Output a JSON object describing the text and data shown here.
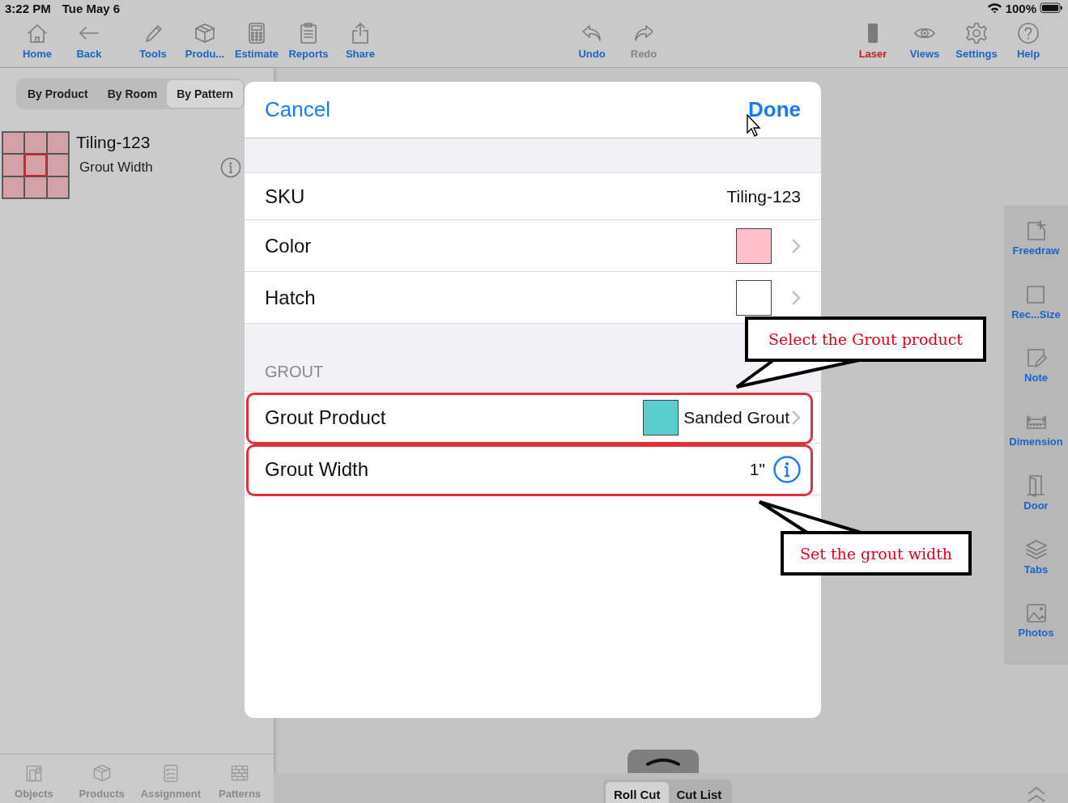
{
  "status_bar": {
    "time": "3:22 PM",
    "date": "Tue May 6",
    "battery": "100%"
  },
  "toolbar": {
    "left": [
      {
        "label": "Home",
        "kind": "home",
        "disabled": false,
        "alert": false
      },
      {
        "label": "Back",
        "kind": "back",
        "disabled": false,
        "alert": false
      },
      {
        "label": "Tools",
        "kind": "pencil",
        "disabled": false,
        "alert": false
      },
      {
        "label": "Produ...",
        "kind": "box",
        "disabled": false,
        "alert": false
      },
      {
        "label": "Estimate",
        "kind": "calculator",
        "disabled": false,
        "alert": false
      },
      {
        "label": "Reports",
        "kind": "clipboard",
        "disabled": false,
        "alert": false
      },
      {
        "label": "Share",
        "kind": "share",
        "disabled": false,
        "alert": false
      }
    ],
    "center": [
      {
        "label": "Undo",
        "kind": "undo",
        "disabled": false,
        "alert": false
      },
      {
        "label": "Redo",
        "kind": "redo",
        "disabled": true,
        "alert": false
      }
    ],
    "right": [
      {
        "label": "Laser",
        "kind": "laser",
        "disabled": false,
        "alert": true
      },
      {
        "label": "Views",
        "kind": "eye",
        "disabled": false,
        "alert": false
      },
      {
        "label": "Settings",
        "kind": "gear",
        "disabled": false,
        "alert": false
      },
      {
        "label": "Help",
        "kind": "help",
        "disabled": false,
        "alert": false
      }
    ]
  },
  "left_panel": {
    "segments": [
      {
        "label": "By Product",
        "selected": false
      },
      {
        "label": "By Room",
        "selected": false
      },
      {
        "label": "By Pattern",
        "selected": true
      }
    ],
    "patterns": [
      {
        "title": "Tiling-123",
        "subtitle": "Grout Width",
        "color": "#d4a1a8"
      }
    ],
    "bottom_tabs": [
      {
        "label": "Objects",
        "kind": "objects"
      },
      {
        "label": "Products",
        "kind": "box"
      },
      {
        "label": "Assignment",
        "kind": "checklist"
      },
      {
        "label": "Patterns",
        "kind": "bricks"
      }
    ]
  },
  "right_tools": [
    {
      "label": "Freedraw",
      "kind": "freedraw"
    },
    {
      "label": "Rec...Size",
      "kind": "square"
    },
    {
      "label": "Note",
      "kind": "note"
    },
    {
      "label": "Dimension",
      "kind": "dimension"
    },
    {
      "label": "Door",
      "kind": "door"
    },
    {
      "label": "Tabs",
      "kind": "layers"
    },
    {
      "label": "Photos",
      "kind": "photo"
    }
  ],
  "bottom_bar": {
    "view_tabs": [
      {
        "label": "Roll Cut",
        "selected": true
      },
      {
        "label": "Cut List",
        "selected": false
      }
    ]
  },
  "dialog": {
    "cancel": "Cancel",
    "done": "Done",
    "rows": [
      {
        "kind": "text",
        "label": "SKU",
        "value": "Tiling-123",
        "highlighted": false
      },
      {
        "kind": "swatch",
        "label": "Color",
        "color": "#ffc0cb",
        "highlighted": false
      },
      {
        "kind": "swatch",
        "label": "Hatch",
        "color": "#ffffff",
        "highlighted": false
      }
    ],
    "section": "GROUT",
    "grout_rows": [
      {
        "kind": "swatch_text",
        "label": "Grout Product",
        "color": "#5acdcd",
        "value": "Sanded Grout",
        "highlighted": true
      },
      {
        "kind": "info",
        "label": "Grout Width",
        "value": "1\"",
        "highlighted": true
      }
    ]
  },
  "annotations": [
    {
      "text": "Select the Grout product"
    },
    {
      "text": "Set the grout width"
    }
  ]
}
